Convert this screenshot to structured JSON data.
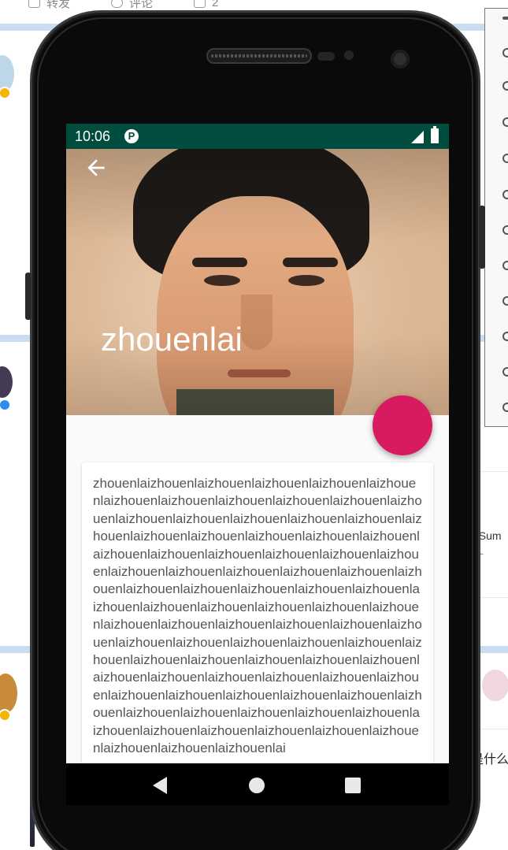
{
  "background": {
    "actions": [
      {
        "label": "转发",
        "icon": "forward-icon"
      },
      {
        "label": "评论",
        "icon": "comment-icon"
      },
      {
        "label": "2",
        "icon": "like-icon"
      }
    ],
    "snippets": {
      "right_1": "f Sum",
      "right_2": "~",
      "right_3": "是什么"
    },
    "side_panel_icons": [
      "minimize-icon",
      "rotate-icon",
      "volume-up-icon",
      "volume-down-icon",
      "rotate-left-icon",
      "rotate-right-icon",
      "camera-icon",
      "zoom-icon",
      "back-icon",
      "home-icon",
      "overview-icon",
      "more-icon"
    ]
  },
  "app": {
    "status_bar": {
      "time": "10:06",
      "notification_icon": "P",
      "signal_icon": "signal-icon",
      "battery_icon": "battery-icon"
    },
    "toolbar": {
      "back_icon": "arrow-back-icon",
      "title": "zhouenlai"
    },
    "fab_color": "#d81b60",
    "status_bar_color": "#004d40",
    "card": {
      "text": "zhouenlaizhouenlaizhouenlaizhouenlaizhouenlaizhouenlaizhouenlaizhouenlaizhouenlaizhouenlaizhouenlaizhouenlaizhouenlaizhouenlaizhouenlaizhouenlaizhouenlaizhouenlaizhouenlaizhouenlaizhouenlaizhouenlaizhouenlaizhouenlaizhouenlaizhouenlaizhouenlaizhouenlaizhouenlaizhouenlaizhouenlaizhouenlaizhouenlaizhouenlaizhouenlaizhouenlaizhouenlaizhouenlaizhouenlaizhouenlaizhouenlaizhouenlaizhouenlaizhouenlaizhouenlaizhouenlaizhouenlaizhouenlaizhouenlaizhouenlaizhouenlaizhouenlaizhouenlaizhouenlaizhouenlaizhouenlaizhouenlaizhouenlaizhouenlaizhouenlaizhouenlaizhouenlaizhouenlaizhouenlaizhouenlaizhouenlaizhouenlaizhouenlaizhouenlaizhouenlaizhouenlaizhouenlaizhouenlaizhouenlaizhouenlaizhouenlaizhouenlaizhouenlaizhouenlaizhouenlaizhouenlaizhouenlaizhouenlaizhouenlaizhouenlaizhouenlaizhouenlaizhouenlaizhouenlai"
    },
    "nav_bar": {
      "back": "nav-back-icon",
      "home": "nav-home-icon",
      "recents": "nav-recents-icon"
    }
  }
}
